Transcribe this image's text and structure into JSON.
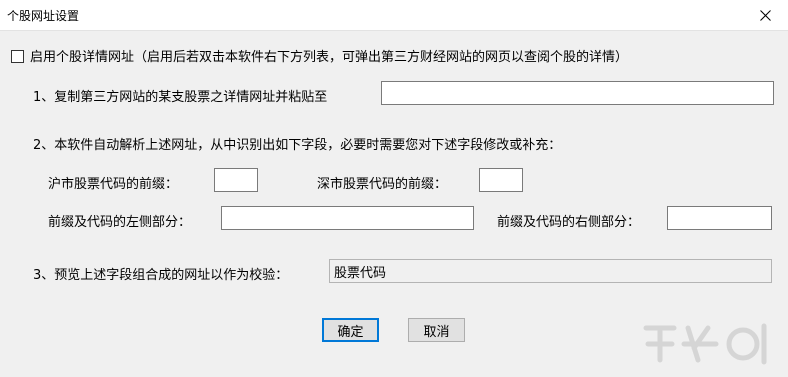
{
  "window": {
    "title": "个股网址设置"
  },
  "enable_checkbox": {
    "label": "启用个股详情网址（启用后若双击本软件右下方列表，可弹出第三方财经网站的网页以查阅个股的详情）",
    "checked": false
  },
  "step1": {
    "label": "1、复制第三方网站的某支股票之详情网址并粘贴至",
    "value": ""
  },
  "step2": {
    "label": "2、本软件自动解析上述网址，从中识别出如下字段，必要时需要您对下述字段修改或补充：",
    "sh_prefix_label": "沪市股票代码的前缀：",
    "sh_prefix_value": "",
    "sz_prefix_label": "深市股票代码的前缀：",
    "sz_prefix_value": "",
    "left_part_label": "前缀及代码的左侧部分：",
    "left_part_value": "",
    "right_part_label": "前缀及代码的右侧部分：",
    "right_part_value": ""
  },
  "step3": {
    "label": "3、预览上述字段组合成的网址以作为校验：",
    "preview_value": "股票代码"
  },
  "buttons": {
    "ok": "确定",
    "cancel": "取消"
  },
  "colors": {
    "window_bg": "#f0f0f0",
    "titlebar_bg": "#ffffff",
    "accent": "#0078d7"
  },
  "icons": {
    "close": "close-icon"
  }
}
